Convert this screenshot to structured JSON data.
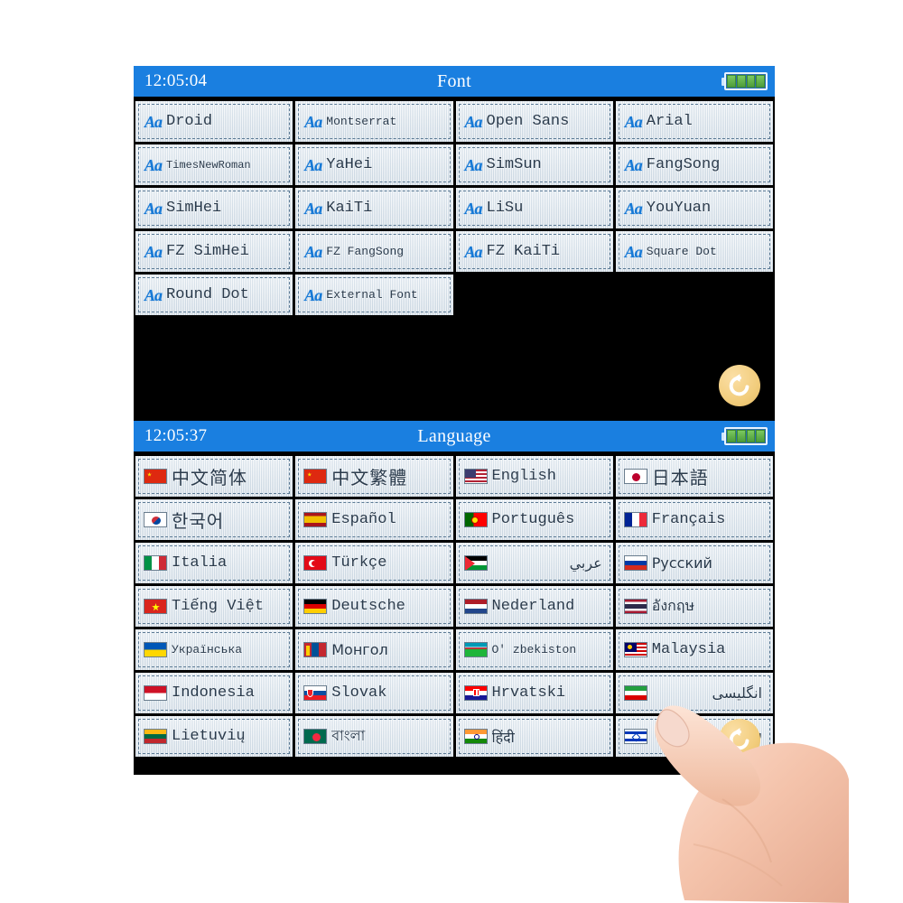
{
  "device": {
    "accent_blue": "#1a7fe0",
    "screen_bg": "#000000",
    "tile_bg": "#dfe7ee",
    "battery_green": "#5db54a",
    "back_button_gold": "#f2cd7d"
  },
  "screens": [
    {
      "id": "font-screen",
      "clock": "12:05:04",
      "title": "Font",
      "battery_cells": 4,
      "back_label": "Back",
      "icon_label": "Aa",
      "items": [
        {
          "label": "Droid",
          "size": "md"
        },
        {
          "label": "Montserrat",
          "size": "sm"
        },
        {
          "label": "Open Sans",
          "size": "md"
        },
        {
          "label": "Arial",
          "size": "md"
        },
        {
          "label": "TimesNewRoman",
          "size": "xsm"
        },
        {
          "label": "YaHei",
          "size": "md"
        },
        {
          "label": "SimSun",
          "size": "md"
        },
        {
          "label": "FangSong",
          "size": "md"
        },
        {
          "label": "SimHei",
          "size": "md"
        },
        {
          "label": "KaiTi",
          "size": "md"
        },
        {
          "label": "LiSu",
          "size": "md"
        },
        {
          "label": "YouYuan",
          "size": "md"
        },
        {
          "label": "FZ SimHei",
          "size": "md"
        },
        {
          "label": "FZ FangSong",
          "size": "sm"
        },
        {
          "label": "FZ KaiTi",
          "size": "md"
        },
        {
          "label": "Square Dot",
          "size": "sm"
        },
        {
          "label": "Round Dot",
          "size": "md"
        },
        {
          "label": "External Font",
          "size": "sm"
        }
      ]
    },
    {
      "id": "language-screen",
      "clock": "12:05:37",
      "title": "Language",
      "battery_cells": 4,
      "back_label": "Back",
      "items": [
        {
          "label": "中文简体",
          "flag": "cn",
          "style": "cjk"
        },
        {
          "label": "中文繁體",
          "flag": "cn",
          "style": "cjk"
        },
        {
          "label": "English",
          "flag": "us",
          "style": "md"
        },
        {
          "label": "日本語",
          "flag": "jp",
          "style": "cjk"
        },
        {
          "label": "한국어",
          "flag": "kr",
          "style": "cjk"
        },
        {
          "label": "Español",
          "flag": "es",
          "style": "md"
        },
        {
          "label": "Português",
          "flag": "pt",
          "style": "md"
        },
        {
          "label": "Français",
          "flag": "fr",
          "style": "md"
        },
        {
          "label": "Italia",
          "flag": "it",
          "style": "md"
        },
        {
          "label": "Türkçe",
          "flag": "tr",
          "style": "md"
        },
        {
          "label": "عربي",
          "flag": "ps",
          "style": "rtl"
        },
        {
          "label": "Русский",
          "flag": "ru",
          "style": "uni"
        },
        {
          "label": "Tiếng Việt",
          "flag": "vn",
          "style": "md"
        },
        {
          "label": "Deutsche",
          "flag": "de",
          "style": "md"
        },
        {
          "label": "Nederland",
          "flag": "nl",
          "style": "md"
        },
        {
          "label": "อังกฤษ",
          "flag": "th",
          "style": "uni"
        },
        {
          "label": "Українська",
          "flag": "ua",
          "style": "sm"
        },
        {
          "label": "Монгол",
          "flag": "mn",
          "style": "uni"
        },
        {
          "label": "O' zbekiston",
          "flag": "uz",
          "style": "sm"
        },
        {
          "label": "Malaysia",
          "flag": "my",
          "style": "md"
        },
        {
          "label": "Indonesia",
          "flag": "id",
          "style": "md"
        },
        {
          "label": "Slovak",
          "flag": "sk",
          "style": "md"
        },
        {
          "label": "Hrvatski",
          "flag": "hr",
          "style": "md"
        },
        {
          "label": "انگلیسی",
          "flag": "ir",
          "style": "rtl"
        },
        {
          "label": "Lietuvių",
          "flag": "lt",
          "style": "md"
        },
        {
          "label": "বাংলা",
          "flag": "bd",
          "style": "uni"
        },
        {
          "label": "हिंदी",
          "flag": "in",
          "style": "uni"
        },
        {
          "label": "עברית",
          "flag": "il",
          "style": "rtl"
        }
      ]
    }
  ]
}
